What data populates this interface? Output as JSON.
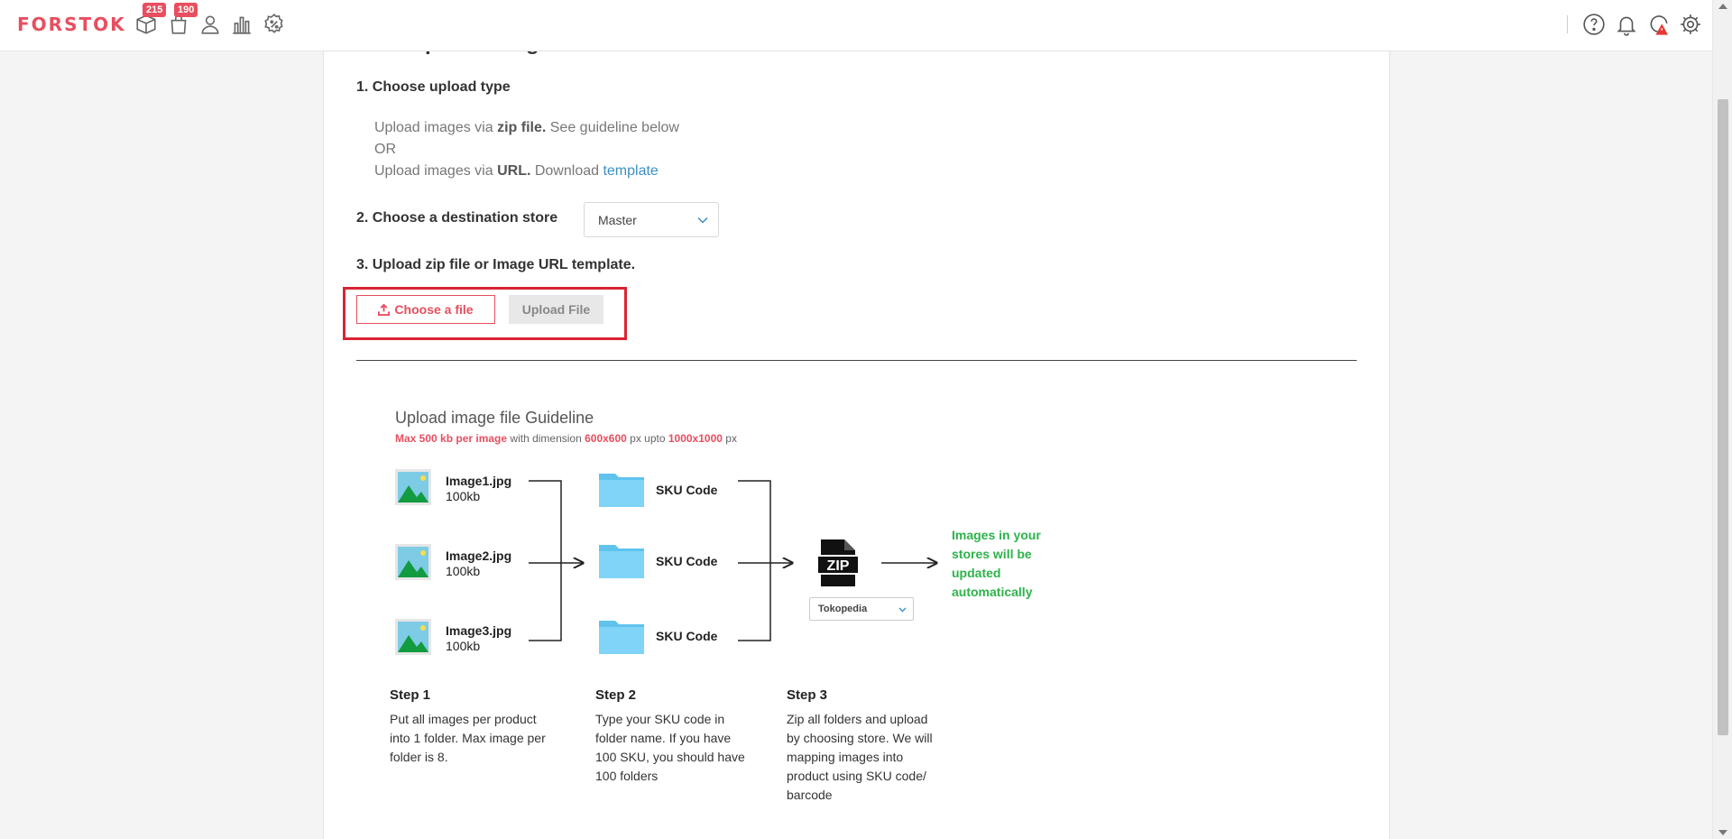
{
  "navbar": {
    "logo": "FORSTOK",
    "badges": {
      "products": "215",
      "orders": "190"
    }
  },
  "page": {
    "title": "Bulk Upload Images",
    "step1": {
      "title": "1. Choose upload type",
      "line1_pre": "Upload images via ",
      "line1_bold": "zip file.",
      "line1_post": " See guideline below",
      "or": "OR",
      "line2_pre": "Upload images via ",
      "line2_bold": "URL.",
      "line2_post": " Download ",
      "line2_link": "template"
    },
    "step2": {
      "title": "2. Choose a destination store",
      "selected": "Master"
    },
    "step3": {
      "title": "3. Upload zip file or Image URL template.",
      "choose_label": "Choose a file",
      "upload_label": "Upload File"
    }
  },
  "guideline": {
    "title": "Upload image file Guideline",
    "limit_red": "Max 500 kb per image",
    "limit_mid": " with dimension ",
    "dim1": "600x600",
    "px1": " px upto ",
    "dim2": "1000x1000",
    "px2": " px",
    "files": [
      {
        "name": "Image1.jpg",
        "size": "100kb"
      },
      {
        "name": "Image2.jpg",
        "size": "100kb"
      },
      {
        "name": "Image3.jpg",
        "size": "100kb"
      }
    ],
    "folders": [
      "SKU Code",
      "SKU Code",
      "SKU Code"
    ],
    "store_select": "Tokopedia",
    "result": "Images in your stores will be updated automatically",
    "steps": [
      {
        "title": "Step 1",
        "body": "Put all images per product into 1 folder. Max image per folder is 8."
      },
      {
        "title": "Step 2",
        "body": "Type your SKU code in folder name. If you have 100 SKU, you should have 100 folders"
      },
      {
        "title": "Step 3",
        "body": "Zip all folders and upload by choosing store. We will mapping images into product using SKU code/ barcode"
      }
    ]
  },
  "colors": {
    "brand": "#e84e5f",
    "link": "#3a8fc7",
    "success": "#2db34a",
    "highlight": "#d92433"
  }
}
